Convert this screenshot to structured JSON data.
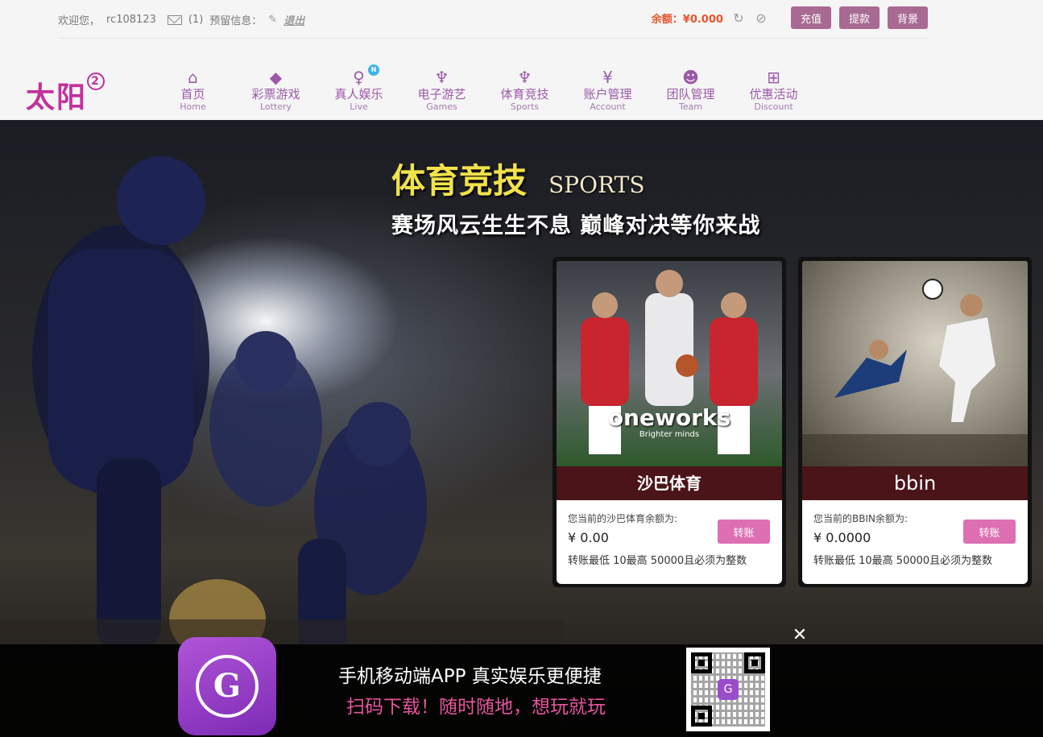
{
  "topbar": {
    "welcome": "欢迎您，",
    "username": "rc108123",
    "mail_count": "(1)",
    "reserve_info": "预留信息：",
    "logout": "退出",
    "balance_label": "余额：",
    "balance_value": "¥0.000",
    "recharge": "充值",
    "withdraw": "提款",
    "background": "背景"
  },
  "logo": {
    "text": "太阳",
    "badge": "2"
  },
  "nav": [
    {
      "zh": "首页",
      "en": "Home",
      "icon": "home-icon"
    },
    {
      "zh": "彩票游戏",
      "en": "Lottery",
      "icon": "ticket-icon"
    },
    {
      "zh": "真人娱乐",
      "en": "Live",
      "icon": "dealer-icon",
      "badge": "N"
    },
    {
      "zh": "电子游艺",
      "en": "Games",
      "icon": "trophy-icon"
    },
    {
      "zh": "体育竞技",
      "en": "Sports",
      "icon": "cup-icon"
    },
    {
      "zh": "账户管理",
      "en": "Account",
      "icon": "yen-coin-icon"
    },
    {
      "zh": "团队管理",
      "en": "Team",
      "icon": "team-icon"
    },
    {
      "zh": "优惠活动",
      "en": "Discount",
      "icon": "gift-icon"
    }
  ],
  "banner": {
    "title_zh": "体育竞技",
    "title_en": "SPORTS",
    "subtitle": "赛场风云生生不息  巅峰对决等你来战"
  },
  "cards": [
    {
      "brand": "oneworks",
      "brand_sub": "Brighter minds",
      "label": "沙巴体育",
      "balance_text": "您当前的沙巴体育余额为:",
      "amount": "¥  0.00",
      "rule": "转账最低 10最高 50000且必须为整数",
      "button": "转账"
    },
    {
      "brand": "bbin",
      "label": "bbin",
      "balance_text": "您当前的BBIN余额为:",
      "amount": "¥  0.0000",
      "rule": "转账最低 10最高 50000且必须为整数",
      "button": "转账"
    }
  ],
  "appbar": {
    "line1": "手机移动端APP 真实娱乐更便捷",
    "line2": "扫码下载！随时随地，想玩就玩",
    "close": "✕"
  },
  "colors": {
    "accent": "#a86a92",
    "nav": "#9c59a8",
    "balance": "#e8542c",
    "xfer": "#dd6fb2"
  }
}
